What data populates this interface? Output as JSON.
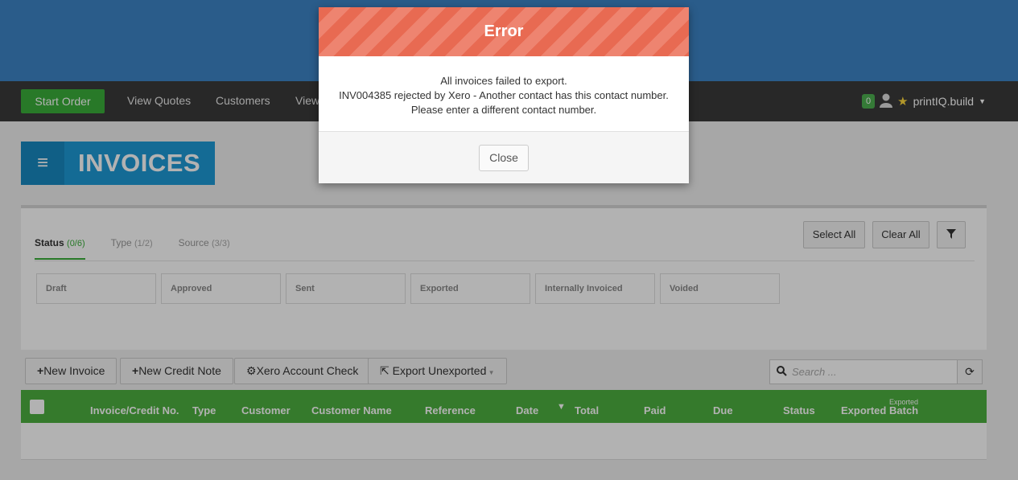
{
  "navbar": {
    "start_order": "Start Order",
    "items": [
      "View Quotes",
      "Customers",
      "View"
    ],
    "notification_count": "0",
    "user_label": "printIQ.build"
  },
  "page": {
    "title": "INVOICES"
  },
  "filters": {
    "tabs": [
      {
        "label": "Status",
        "count": "(0/6)"
      },
      {
        "label": "Type",
        "count": "(1/2)"
      },
      {
        "label": "Source",
        "count": "(3/3)"
      }
    ],
    "select_all": "Select All",
    "clear_all": "Clear All",
    "statuses": [
      "Draft",
      "Approved",
      "Sent",
      "Exported",
      "Internally Invoiced",
      "Voided"
    ]
  },
  "toolbar": {
    "new_invoice": "New Invoice",
    "new_credit_note": "New Credit Note",
    "xero_account_check": "Xero Account Check",
    "export_unexported": "Export Unexported",
    "search_placeholder": "Search ..."
  },
  "table": {
    "columns": [
      "Invoice/Credit No.",
      "Type",
      "Customer",
      "Customer Name",
      "Reference",
      "Date",
      "Total",
      "Paid",
      "Due",
      "Status",
      "Exported",
      "Batch"
    ],
    "batch_sub_label": "Exported"
  },
  "modal": {
    "title": "Error",
    "line1": "All invoices failed to export.",
    "line2": "INV004385 rejected by Xero - Another contact has this contact number.",
    "line3": "Please enter a different contact number.",
    "close": "Close"
  },
  "colors": {
    "accent_green": "#4caf3f",
    "header_blue": "#3d84c6",
    "error_red": "#e86a52"
  }
}
